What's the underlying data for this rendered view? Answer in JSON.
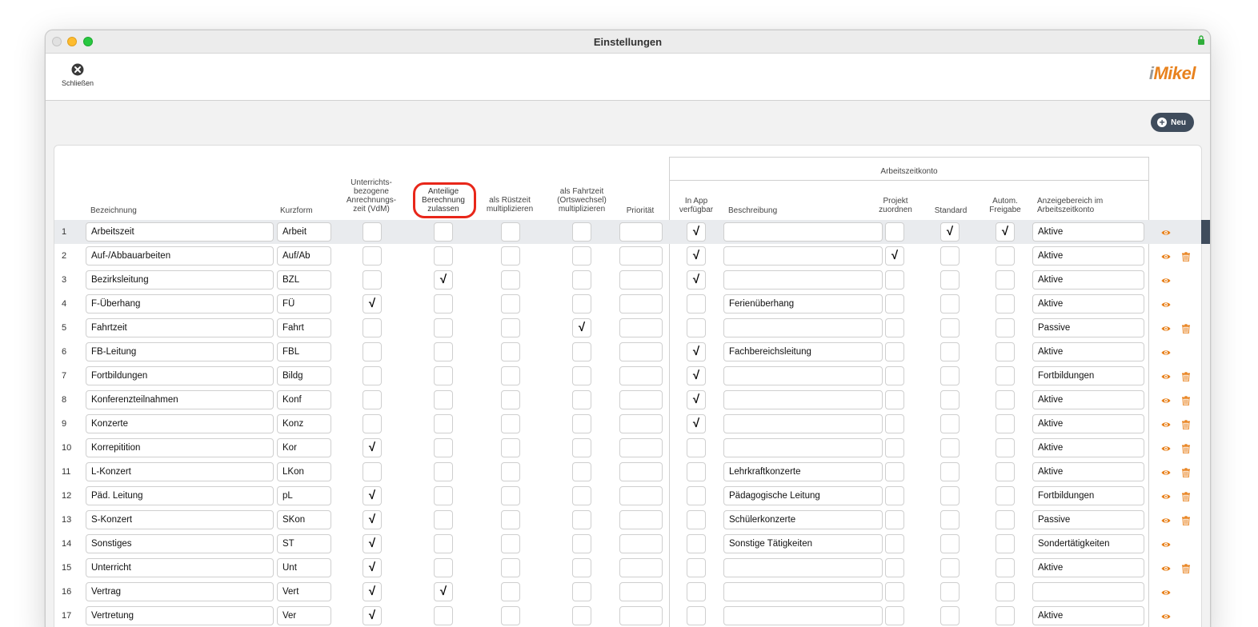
{
  "window": {
    "title": "Einstellungen"
  },
  "toolbar": {
    "close_label": "Schließen",
    "logo_i": "i",
    "logo_text": "Mikel"
  },
  "actions": {
    "new_label": "Neu"
  },
  "colors": {
    "accent": "#e8821e",
    "dark_button": "#3f4c5c",
    "highlight_ring": "#e8271a"
  },
  "headers": {
    "bezeichnung": "Bezeichnung",
    "kurzform": "Kurzform",
    "unterrichts": "Unterrichts-\nbezogene\nAnrechnungs-\nzeit (VdM)",
    "anteilige": "Anteilige\nBerechnung\nzulassen",
    "ruestzeit": "als Rüstzeit\nmultiplizieren",
    "fahrtzeit": "als Fahrtzeit\n(Ortswechsel)\nmultiplizieren",
    "prioritaet": "Priorität",
    "arbeitszeitkonto": "Arbeitszeitkonto",
    "in_app": "In App\nverfügbar",
    "beschreibung": "Beschreibung",
    "projekt": "Projekt\nzuordnen",
    "standard": "Standard",
    "autom": "Autom.\nFreigabe",
    "anzeige": "Anzeigebereich im\nArbeitszeitkonto"
  },
  "check_glyph": "√",
  "icons": {
    "view": "eye-icon",
    "delete": "trash-icon",
    "close": "close-circle-icon",
    "add": "plus-circle-icon"
  },
  "rows": [
    {
      "num": "1",
      "name": "Arbeitszeit",
      "short": "Arbeit",
      "vdm": false,
      "anteilig": false,
      "ruest": false,
      "fahrt": false,
      "prio": "",
      "app": true,
      "desc": "",
      "projekt": false,
      "standard": true,
      "autom": true,
      "anzeige": "Aktive",
      "delete": false,
      "selected": true
    },
    {
      "num": "2",
      "name": "Auf-/Abbauarbeiten",
      "short": "Auf/Ab",
      "vdm": false,
      "anteilig": false,
      "ruest": false,
      "fahrt": false,
      "prio": "",
      "app": true,
      "desc": "",
      "projekt": true,
      "standard": false,
      "autom": false,
      "anzeige": "Aktive",
      "delete": true
    },
    {
      "num": "3",
      "name": "Bezirksleitung",
      "short": "BZL",
      "vdm": false,
      "anteilig": true,
      "ruest": false,
      "fahrt": false,
      "prio": "",
      "app": true,
      "desc": "",
      "projekt": false,
      "standard": false,
      "autom": false,
      "anzeige": "Aktive",
      "delete": false
    },
    {
      "num": "4",
      "name": "F-Überhang",
      "short": "FÜ",
      "vdm": true,
      "anteilig": false,
      "ruest": false,
      "fahrt": false,
      "prio": "",
      "app": false,
      "desc": "Ferienüberhang",
      "projekt": false,
      "standard": false,
      "autom": false,
      "anzeige": "Aktive",
      "delete": false
    },
    {
      "num": "5",
      "name": "Fahrtzeit",
      "short": "Fahrt",
      "vdm": false,
      "anteilig": false,
      "ruest": false,
      "fahrt": true,
      "prio": "",
      "app": false,
      "desc": "",
      "projekt": false,
      "standard": false,
      "autom": false,
      "anzeige": "Passive",
      "delete": true
    },
    {
      "num": "6",
      "name": "FB-Leitung",
      "short": "FBL",
      "vdm": false,
      "anteilig": false,
      "ruest": false,
      "fahrt": false,
      "prio": "",
      "app": true,
      "desc": "Fachbereichsleitung",
      "projekt": false,
      "standard": false,
      "autom": false,
      "anzeige": "Aktive",
      "delete": false
    },
    {
      "num": "7",
      "name": "Fortbildungen",
      "short": "Bildg",
      "vdm": false,
      "anteilig": false,
      "ruest": false,
      "fahrt": false,
      "prio": "",
      "app": true,
      "desc": "",
      "projekt": false,
      "standard": false,
      "autom": false,
      "anzeige": "Fortbildungen",
      "delete": true
    },
    {
      "num": "8",
      "name": "Konferenzteilnahmen",
      "short": "Konf",
      "vdm": false,
      "anteilig": false,
      "ruest": false,
      "fahrt": false,
      "prio": "",
      "app": true,
      "desc": "",
      "projekt": false,
      "standard": false,
      "autom": false,
      "anzeige": "Aktive",
      "delete": true
    },
    {
      "num": "9",
      "name": "Konzerte",
      "short": "Konz",
      "vdm": false,
      "anteilig": false,
      "ruest": false,
      "fahrt": false,
      "prio": "",
      "app": true,
      "desc": "",
      "projekt": false,
      "standard": false,
      "autom": false,
      "anzeige": "Aktive",
      "delete": true
    },
    {
      "num": "10",
      "name": "Korrepitition",
      "short": "Kor",
      "vdm": true,
      "anteilig": false,
      "ruest": false,
      "fahrt": false,
      "prio": "",
      "app": false,
      "desc": "",
      "projekt": false,
      "standard": false,
      "autom": false,
      "anzeige": "Aktive",
      "delete": true
    },
    {
      "num": "11",
      "name": "L-Konzert",
      "short": "LKon",
      "vdm": false,
      "anteilig": false,
      "ruest": false,
      "fahrt": false,
      "prio": "",
      "app": false,
      "desc": "Lehrkraftkonzerte",
      "projekt": false,
      "standard": false,
      "autom": false,
      "anzeige": "Aktive",
      "delete": true
    },
    {
      "num": "12",
      "name": "Päd. Leitung",
      "short": "pL",
      "vdm": true,
      "anteilig": false,
      "ruest": false,
      "fahrt": false,
      "prio": "",
      "app": false,
      "desc": "Pädagogische Leitung",
      "projekt": false,
      "standard": false,
      "autom": false,
      "anzeige": "Fortbildungen",
      "delete": true
    },
    {
      "num": "13",
      "name": "S-Konzert",
      "short": "SKon",
      "vdm": true,
      "anteilig": false,
      "ruest": false,
      "fahrt": false,
      "prio": "",
      "app": false,
      "desc": "Schülerkonzerte",
      "projekt": false,
      "standard": false,
      "autom": false,
      "anzeige": "Passive",
      "delete": true
    },
    {
      "num": "14",
      "name": "Sonstiges",
      "short": "ST",
      "vdm": true,
      "anteilig": false,
      "ruest": false,
      "fahrt": false,
      "prio": "",
      "app": false,
      "desc": "Sonstige Tätigkeiten",
      "projekt": false,
      "standard": false,
      "autom": false,
      "anzeige": "Sondertätigkeiten",
      "delete": false
    },
    {
      "num": "15",
      "name": "Unterricht",
      "short": "Unt",
      "vdm": true,
      "anteilig": false,
      "ruest": false,
      "fahrt": false,
      "prio": "",
      "app": false,
      "desc": "",
      "projekt": false,
      "standard": false,
      "autom": false,
      "anzeige": "Aktive",
      "delete": true
    },
    {
      "num": "16",
      "name": "Vertrag",
      "short": "Vert",
      "vdm": true,
      "anteilig": true,
      "ruest": false,
      "fahrt": false,
      "prio": "",
      "app": false,
      "desc": "",
      "projekt": false,
      "standard": false,
      "autom": false,
      "anzeige": "",
      "delete": false
    },
    {
      "num": "17",
      "name": "Vertretung",
      "short": "Ver",
      "vdm": true,
      "anteilig": false,
      "ruest": false,
      "fahrt": false,
      "prio": "",
      "app": false,
      "desc": "",
      "projekt": false,
      "standard": false,
      "autom": false,
      "anzeige": "Aktive",
      "delete": false
    }
  ]
}
